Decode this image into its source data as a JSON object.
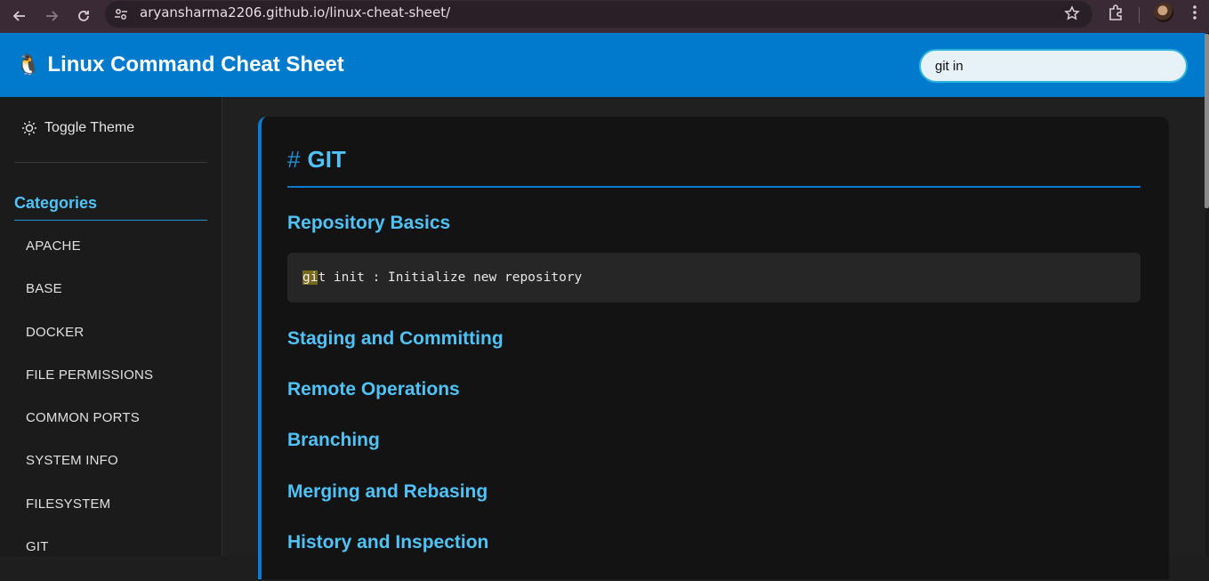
{
  "browser": {
    "url": "aryansharma2206.github.io/linux-cheat-sheet/"
  },
  "header": {
    "icon": "🐧",
    "title": "Linux Command Cheat Sheet",
    "search_value": "git in"
  },
  "sidebar": {
    "toggle_label": "Toggle Theme",
    "categories_heading": "Categories",
    "categories": [
      "APACHE",
      "BASE",
      "DOCKER",
      "FILE PERMISSIONS",
      "COMMON PORTS",
      "SYSTEM INFO",
      "FILESYSTEM",
      "GIT"
    ]
  },
  "main": {
    "section_hash": "#",
    "section_title": "GIT",
    "subsections": [
      "Repository Basics",
      "Staging and Committing",
      "Remote Operations",
      "Branching",
      "Merging and Rebasing",
      "History and Inspection"
    ],
    "code": {
      "highlight": "gi",
      "rest": "t init : Initialize new repository"
    }
  },
  "colors": {
    "accent": "#007acc",
    "heading": "#4fc3f7",
    "highlight": "#776a1e"
  }
}
